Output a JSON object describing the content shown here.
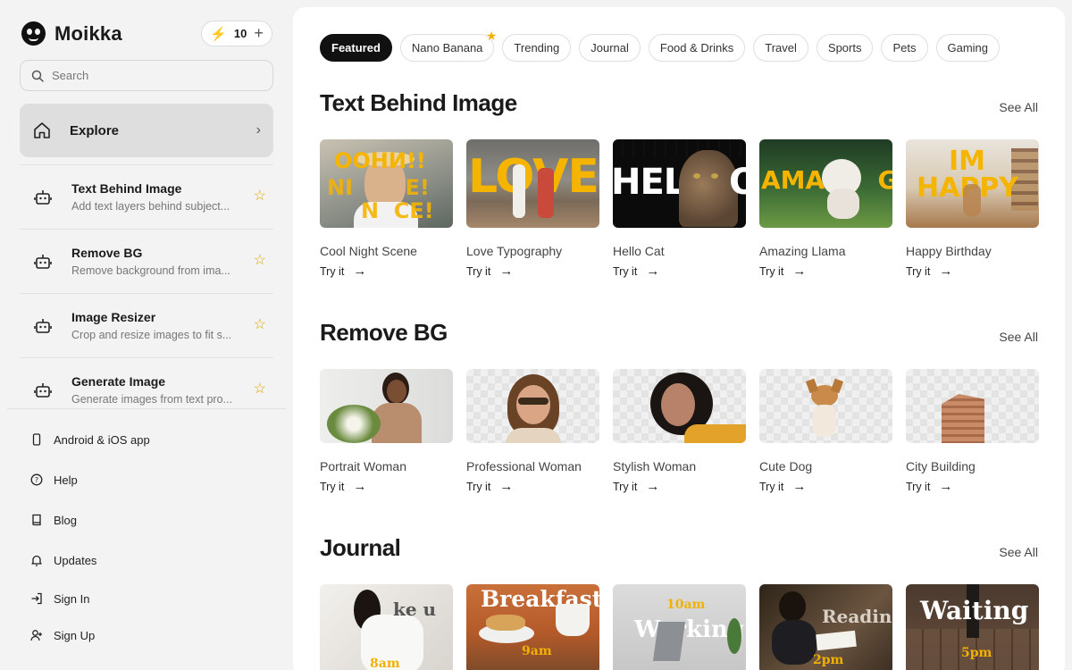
{
  "brand": {
    "name": "Moikka",
    "credits": "10"
  },
  "search": {
    "placeholder": "Search"
  },
  "nav": {
    "explore": "Explore"
  },
  "tools": [
    {
      "title": "Text Behind Image",
      "desc": "Add text layers behind subject..."
    },
    {
      "title": "Remove BG",
      "desc": "Remove background from ima..."
    },
    {
      "title": "Image Resizer",
      "desc": "Crop and resize images to fit s..."
    },
    {
      "title": "Generate Image",
      "desc": "Generate images from text pro..."
    }
  ],
  "bottom_links": [
    "Android & iOS app",
    "Help",
    "Blog",
    "Updates",
    "Sign In",
    "Sign Up"
  ],
  "chips": [
    "Featured",
    "Nano Banana",
    "Trending",
    "Journal",
    "Food & Drinks",
    "Travel",
    "Sports",
    "Pets",
    "Gaming"
  ],
  "see_all": "See All",
  "try_it": "Try it",
  "sections": [
    {
      "title": "Text Behind Image",
      "cards": [
        {
          "title": "Cool Night Scene",
          "overlay": "ООНИ!!\nNI  E!\nN  CE!"
        },
        {
          "title": "Love Typography",
          "overlay": "LOVE"
        },
        {
          "title": "Hello Cat",
          "overlay": "HEL  O"
        },
        {
          "title": "Amazing Llama",
          "overlay": "AMAZ  G!"
        },
        {
          "title": "Happy Birthday",
          "overlay": "IM\nHAPPY"
        }
      ]
    },
    {
      "title": "Remove BG",
      "cards": [
        {
          "title": "Portrait Woman"
        },
        {
          "title": "Professional Woman"
        },
        {
          "title": "Stylish Woman"
        },
        {
          "title": "Cute Dog"
        },
        {
          "title": "City Building"
        }
      ]
    },
    {
      "title": "Journal",
      "cards": [
        {
          "title": "",
          "overlay": "ke u",
          "sub": "8am"
        },
        {
          "title": "",
          "overlay": "Breakfast",
          "sub": "9am"
        },
        {
          "title": "",
          "overlay": "Working",
          "top": "10am"
        },
        {
          "title": "",
          "overlay": "Reading",
          "sub": "2pm"
        },
        {
          "title": "",
          "overlay": "Waiting",
          "sub": "5pm"
        }
      ]
    }
  ],
  "colors": {
    "accent": "#f5b400",
    "active_chip": "#111111",
    "sidebar_bg": "#f3f3f3"
  }
}
